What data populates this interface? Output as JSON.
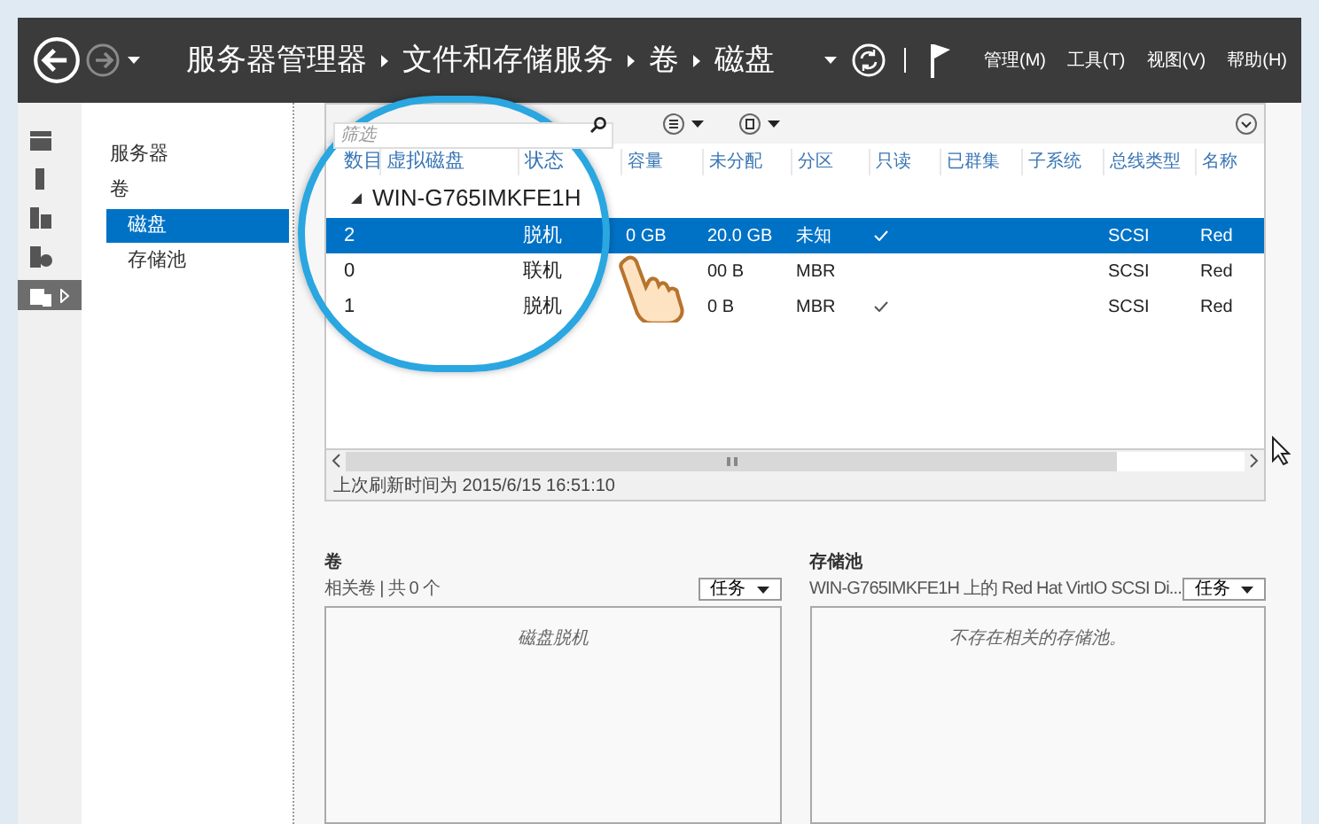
{
  "header": {
    "breadcrumb": [
      "服务器管理器",
      "文件和存储服务",
      "卷",
      "磁盘"
    ],
    "menus": [
      "管理(M)",
      "工具(T)",
      "视图(V)",
      "帮助(H)"
    ]
  },
  "sidebar_icons": [
    {
      "selected": false
    },
    {
      "selected": false
    },
    {
      "selected": false
    },
    {
      "selected": false
    },
    {
      "selected": true
    }
  ],
  "nav": {
    "items": [
      {
        "label": "服务器",
        "selected": false
      },
      {
        "label": "卷",
        "selected": false,
        "children": [
          {
            "label": "磁盘",
            "selected": true
          },
          {
            "label": "存储池",
            "selected": false
          }
        ]
      }
    ]
  },
  "disks": {
    "filter_placeholder": "筛选",
    "columns": [
      "数目",
      "虚拟磁盘",
      "状态",
      "容量",
      "未分配",
      "分区",
      "只读",
      "已群集",
      "子系统",
      "总线类型",
      "名称"
    ],
    "group": "WIN-G765IMKFE1H",
    "rows": [
      {
        "number": "2",
        "status": "脱机",
        "capacity": "0 GB",
        "unallocated": "20.0 GB",
        "partition": "未知",
        "read_only": true,
        "bus_type": "SCSI",
        "name": "Red",
        "selected": true
      },
      {
        "number": "0",
        "status": "联机",
        "unallocated": "00 B",
        "partition": "MBR",
        "read_only": false,
        "bus_type": "SCSI",
        "name": "Red",
        "selected": false
      },
      {
        "number": "1",
        "status": "脱机",
        "unallocated": "0 B",
        "partition": "MBR",
        "read_only": true,
        "bus_type": "SCSI",
        "name": "Red",
        "selected": false
      }
    ],
    "last_refresh": "上次刷新时间为 2015/6/15 16:51:10"
  },
  "volumes": {
    "title": "卷",
    "subtitle": "相关卷 | 共 0 个",
    "task_button": "任务",
    "message": "磁盘脱机"
  },
  "storage_pool": {
    "title": "存储池",
    "subtitle": "WIN-G765IMKFE1H 上的 Red Hat VirtIO SCSI Di...",
    "task_button": "任务",
    "message": "不存在相关的存储池。"
  }
}
